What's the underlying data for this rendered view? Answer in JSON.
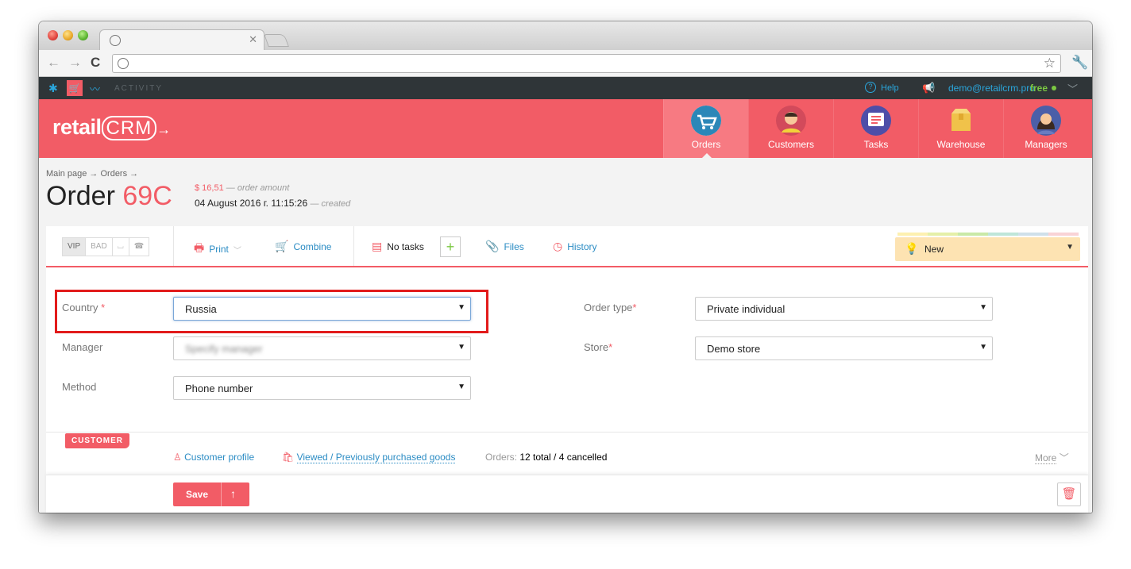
{
  "topbar": {
    "activity_label": "ACTIVITY",
    "help_label": "Help",
    "user_email": "demo@retailcrm.pro",
    "plan_label": "free"
  },
  "header": {
    "logo_text": "retail",
    "logo_crm": "CRM",
    "nav": [
      {
        "label": "Orders",
        "icon": "cart-icon",
        "active": true
      },
      {
        "label": "Customers",
        "icon": "customer-avatar-icon",
        "active": false
      },
      {
        "label": "Tasks",
        "icon": "tasks-list-icon",
        "active": false
      },
      {
        "label": "Warehouse",
        "icon": "box-icon",
        "active": false
      },
      {
        "label": "Managers",
        "icon": "manager-avatar-icon",
        "active": false
      }
    ]
  },
  "breadcrumb": {
    "text": "Main page → Orders →"
  },
  "order": {
    "title_prefix": "Order",
    "number": "69C",
    "amount": "$ 16,51",
    "amount_note": "— order amount",
    "created_at": "04 August 2016 г. 11:15:26",
    "created_note": "— created"
  },
  "toolbar": {
    "segments": [
      "VIP",
      "BAD"
    ],
    "print": "Print",
    "combine": "Combine",
    "tasks": "No tasks",
    "plus": "+",
    "files": "Files",
    "history": "History",
    "status": "New",
    "status_colors": [
      "#fdf0b0",
      "#e5efa8",
      "#c9e9a7",
      "#bfe6d9",
      "#cfe0ea",
      "#f9d3d6"
    ]
  },
  "form": {
    "country_label": "Country",
    "country_value": "Russia",
    "manager_label": "Manager",
    "manager_placeholder": "Specify manager",
    "method_label": "Method",
    "method_value": "Phone number",
    "order_type_label": "Order type",
    "order_type_value": "Private individual",
    "store_label": "Store",
    "store_value": "Demo store",
    "required_mark": "*",
    "arrow": "▼"
  },
  "customer": {
    "tag": "CUSTOMER",
    "profile_link": "Customer profile",
    "goods_link": "Viewed / Previously purchased goods",
    "orders_label": "Orders:",
    "orders_value": "12 total / 4 cancelled",
    "more": "More"
  },
  "footer": {
    "save_label": "Save"
  }
}
